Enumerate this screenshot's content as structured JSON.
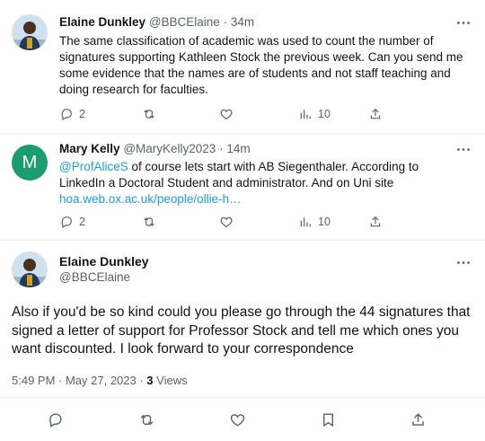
{
  "tweets": [
    {
      "name": "Elaine Dunkley",
      "handle": "@BBCElaine",
      "time": "· 34m",
      "text": "The same classification of academic was used to count the number of signatures supporting Kathleen Stock the previous week. Can you send me some evidence that the names are of students and not staff teaching and doing research for faculties.",
      "replies": "2",
      "views": "10"
    },
    {
      "name": "Mary Kelly",
      "handle": "@MaryKelly2023",
      "time": "· 14m",
      "avatar_letter": "M",
      "mention": "@ProfAliceS",
      "text": " of course lets start with AB Siegenthaler. According to LinkedIn a Doctoral Student and administrator. And on Uni site ",
      "link": "hoa.web.ox.ac.uk/people/ollie-h…",
      "replies": "2",
      "views": "10"
    }
  ],
  "main": {
    "name": "Elaine Dunkley",
    "handle": "@BBCElaine",
    "text": "Also if you'd be so kind could you please go through the 44 signatures that signed a letter of support for Professor Stock and tell me which ones you want discounted. I look forward to your correspondence",
    "timestamp": "5:49 PM · May 27, 2023 · ",
    "views_count": "3",
    "views_label": " Views"
  },
  "colors": {
    "accent": "#1d9bf0",
    "muted": "#536471",
    "avatar_green": "#1a9e6f"
  }
}
